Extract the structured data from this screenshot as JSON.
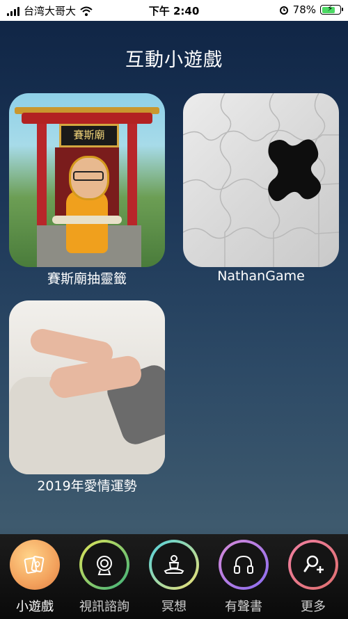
{
  "status_bar": {
    "carrier": "台湾大哥大",
    "time": "下午 2:40",
    "battery_percent": "78%",
    "battery_level": 0.78
  },
  "page": {
    "title": "互動小遊戲"
  },
  "games": [
    {
      "label": "賽斯廟抽靈籤",
      "image": "temple-monkey-cartoon",
      "sign_text": "賽斯廟"
    },
    {
      "label": "NathanGame",
      "image": "jigsaw-puzzle"
    },
    {
      "label": "2019年愛情運勢",
      "image": "clasped-hands"
    }
  ],
  "tabs": [
    {
      "label": "小遊戲",
      "icon": "cards-icon",
      "active": true
    },
    {
      "label": "視訊諮詢",
      "icon": "webcam-icon",
      "active": false
    },
    {
      "label": "冥想",
      "icon": "meditation-icon",
      "active": false
    },
    {
      "label": "有聲書",
      "icon": "headphones-icon",
      "active": false
    },
    {
      "label": "更多",
      "icon": "add-user-search-icon",
      "active": false
    }
  ],
  "colors": {
    "background_top": "#0f2444",
    "tab_active": "#f3a25d",
    "battery_fill": "#4cd964"
  }
}
